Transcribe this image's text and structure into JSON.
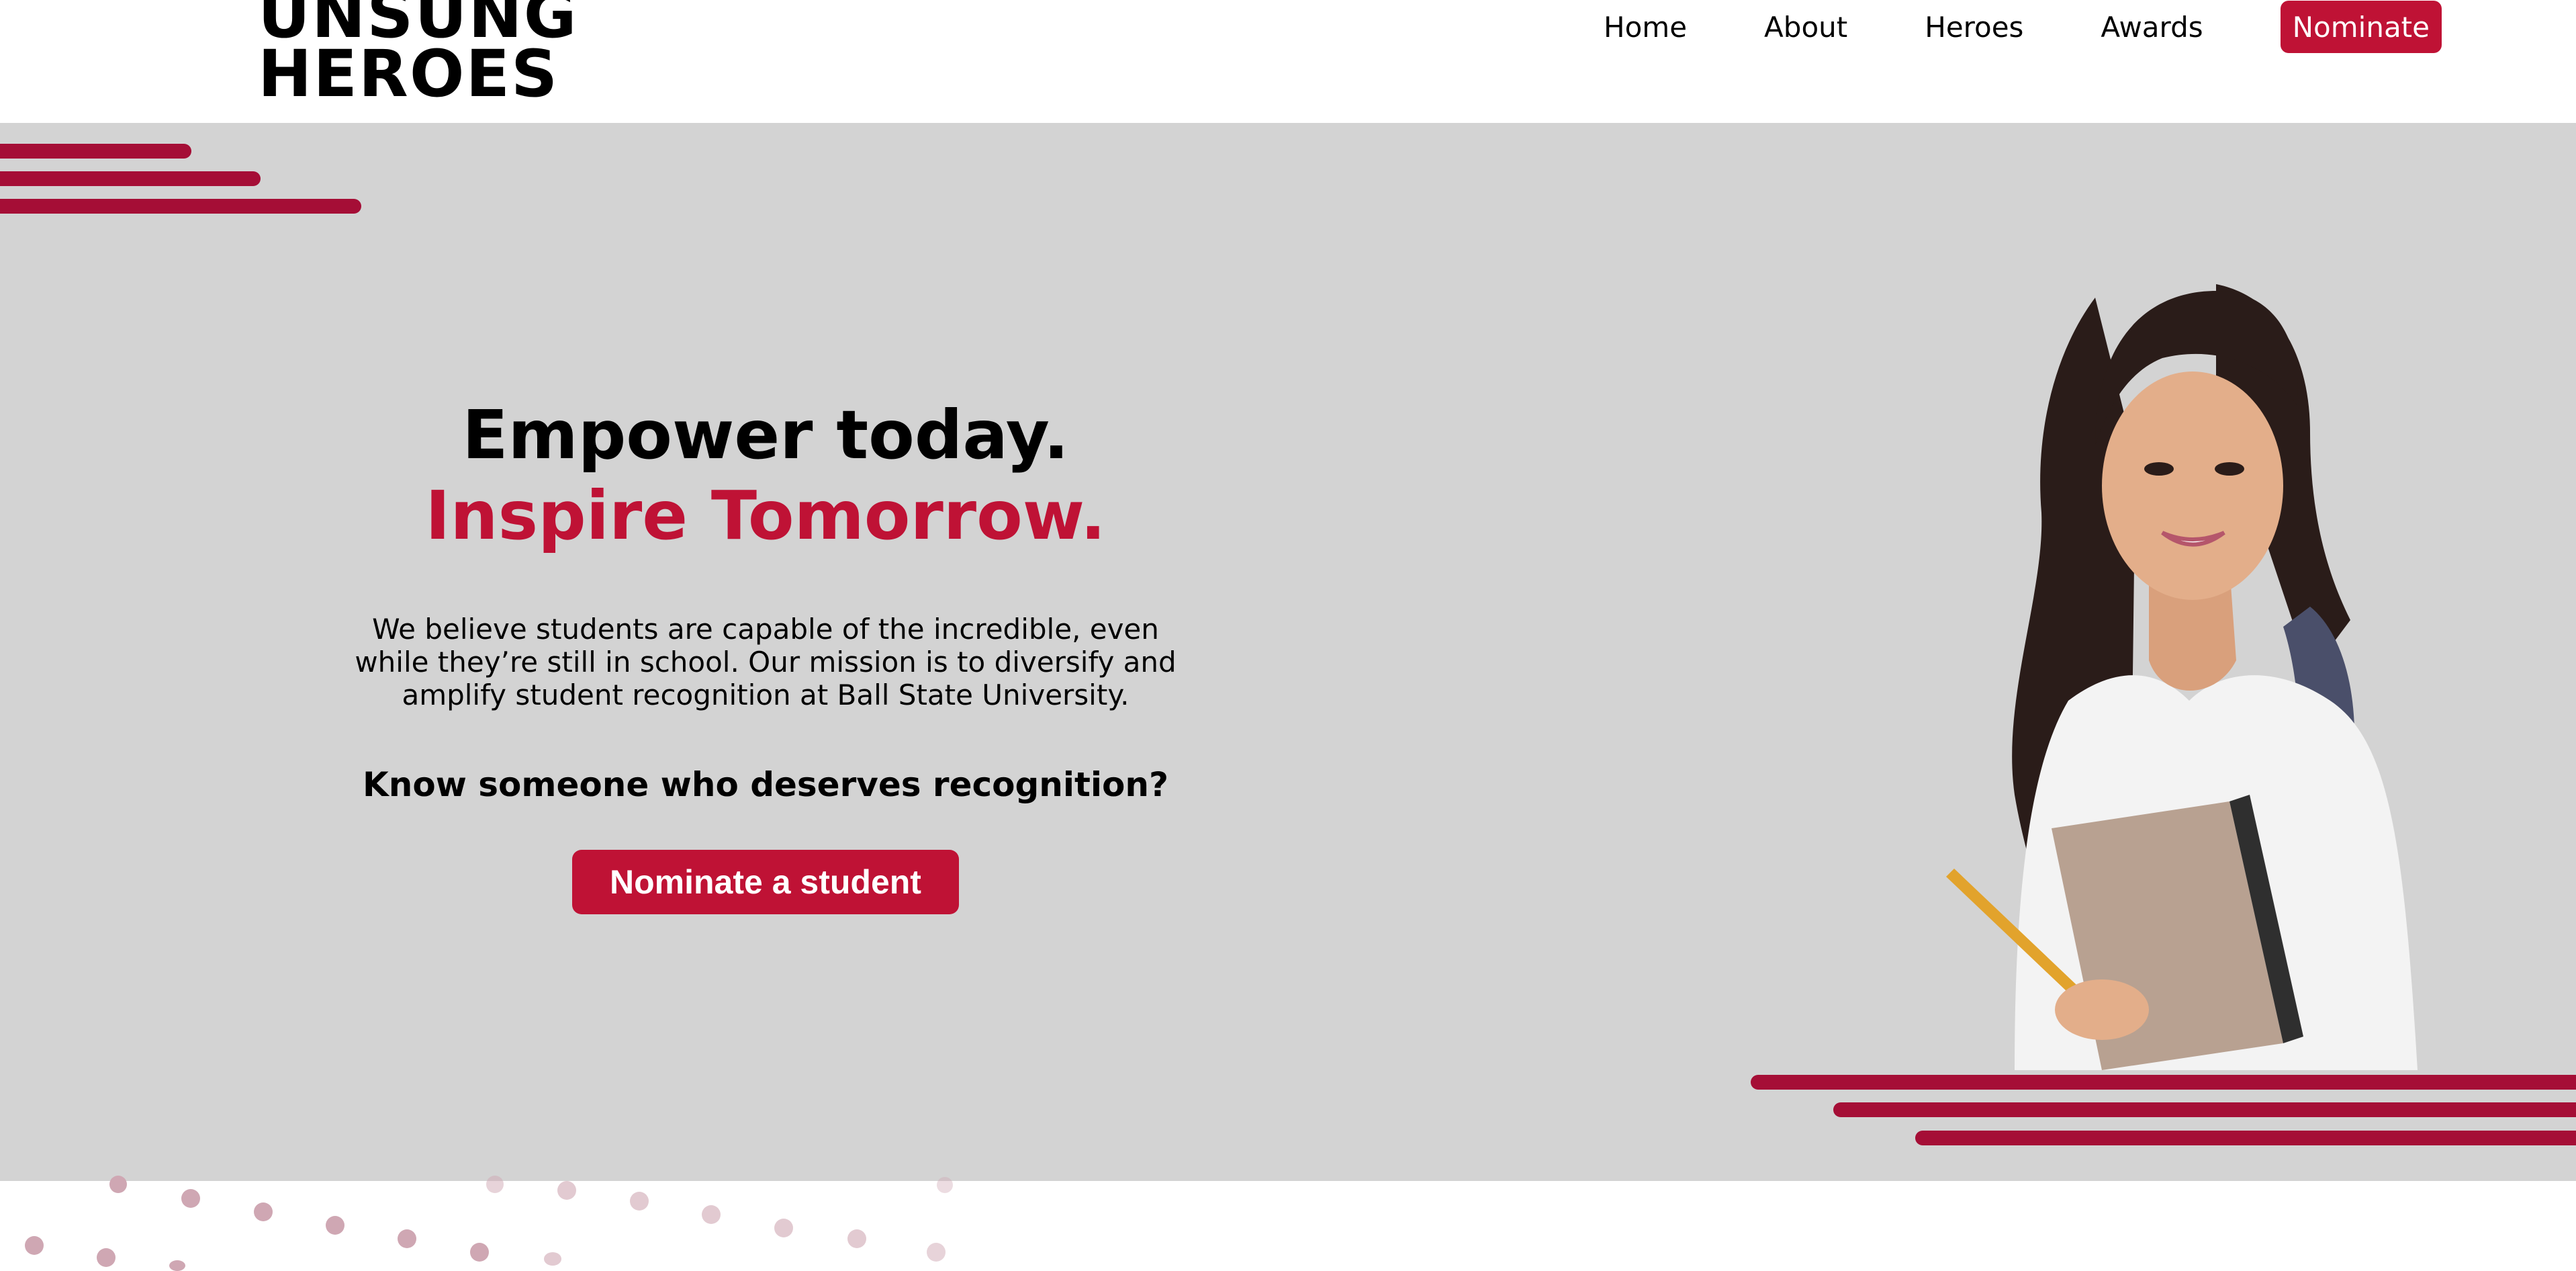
{
  "header": {
    "logo": {
      "line1": "UNSUNG",
      "line2": "HEROES"
    },
    "nav": [
      "Home",
      "About",
      "Heroes",
      "Awards"
    ],
    "nominate_label": "Nominate"
  },
  "hero": {
    "headline_1": "Empower today.",
    "headline_2": "Inspire Tomorrow.",
    "paragraph": "We believe students are capable of the incredible, even while they’re still in school. Our mission is to diversify and amplify student recognition at Ball State University.",
    "question": "Know someone who deserves recognition?",
    "cta_label": "Nominate a student"
  },
  "colors": {
    "accent": "#bf1235",
    "stripe": "#a50e36",
    "hero_bg": "#d3d3d3",
    "dot": "#cfa7b3"
  },
  "icons": {
    "hero_image": "student-photo",
    "decor": "dot-pattern"
  }
}
